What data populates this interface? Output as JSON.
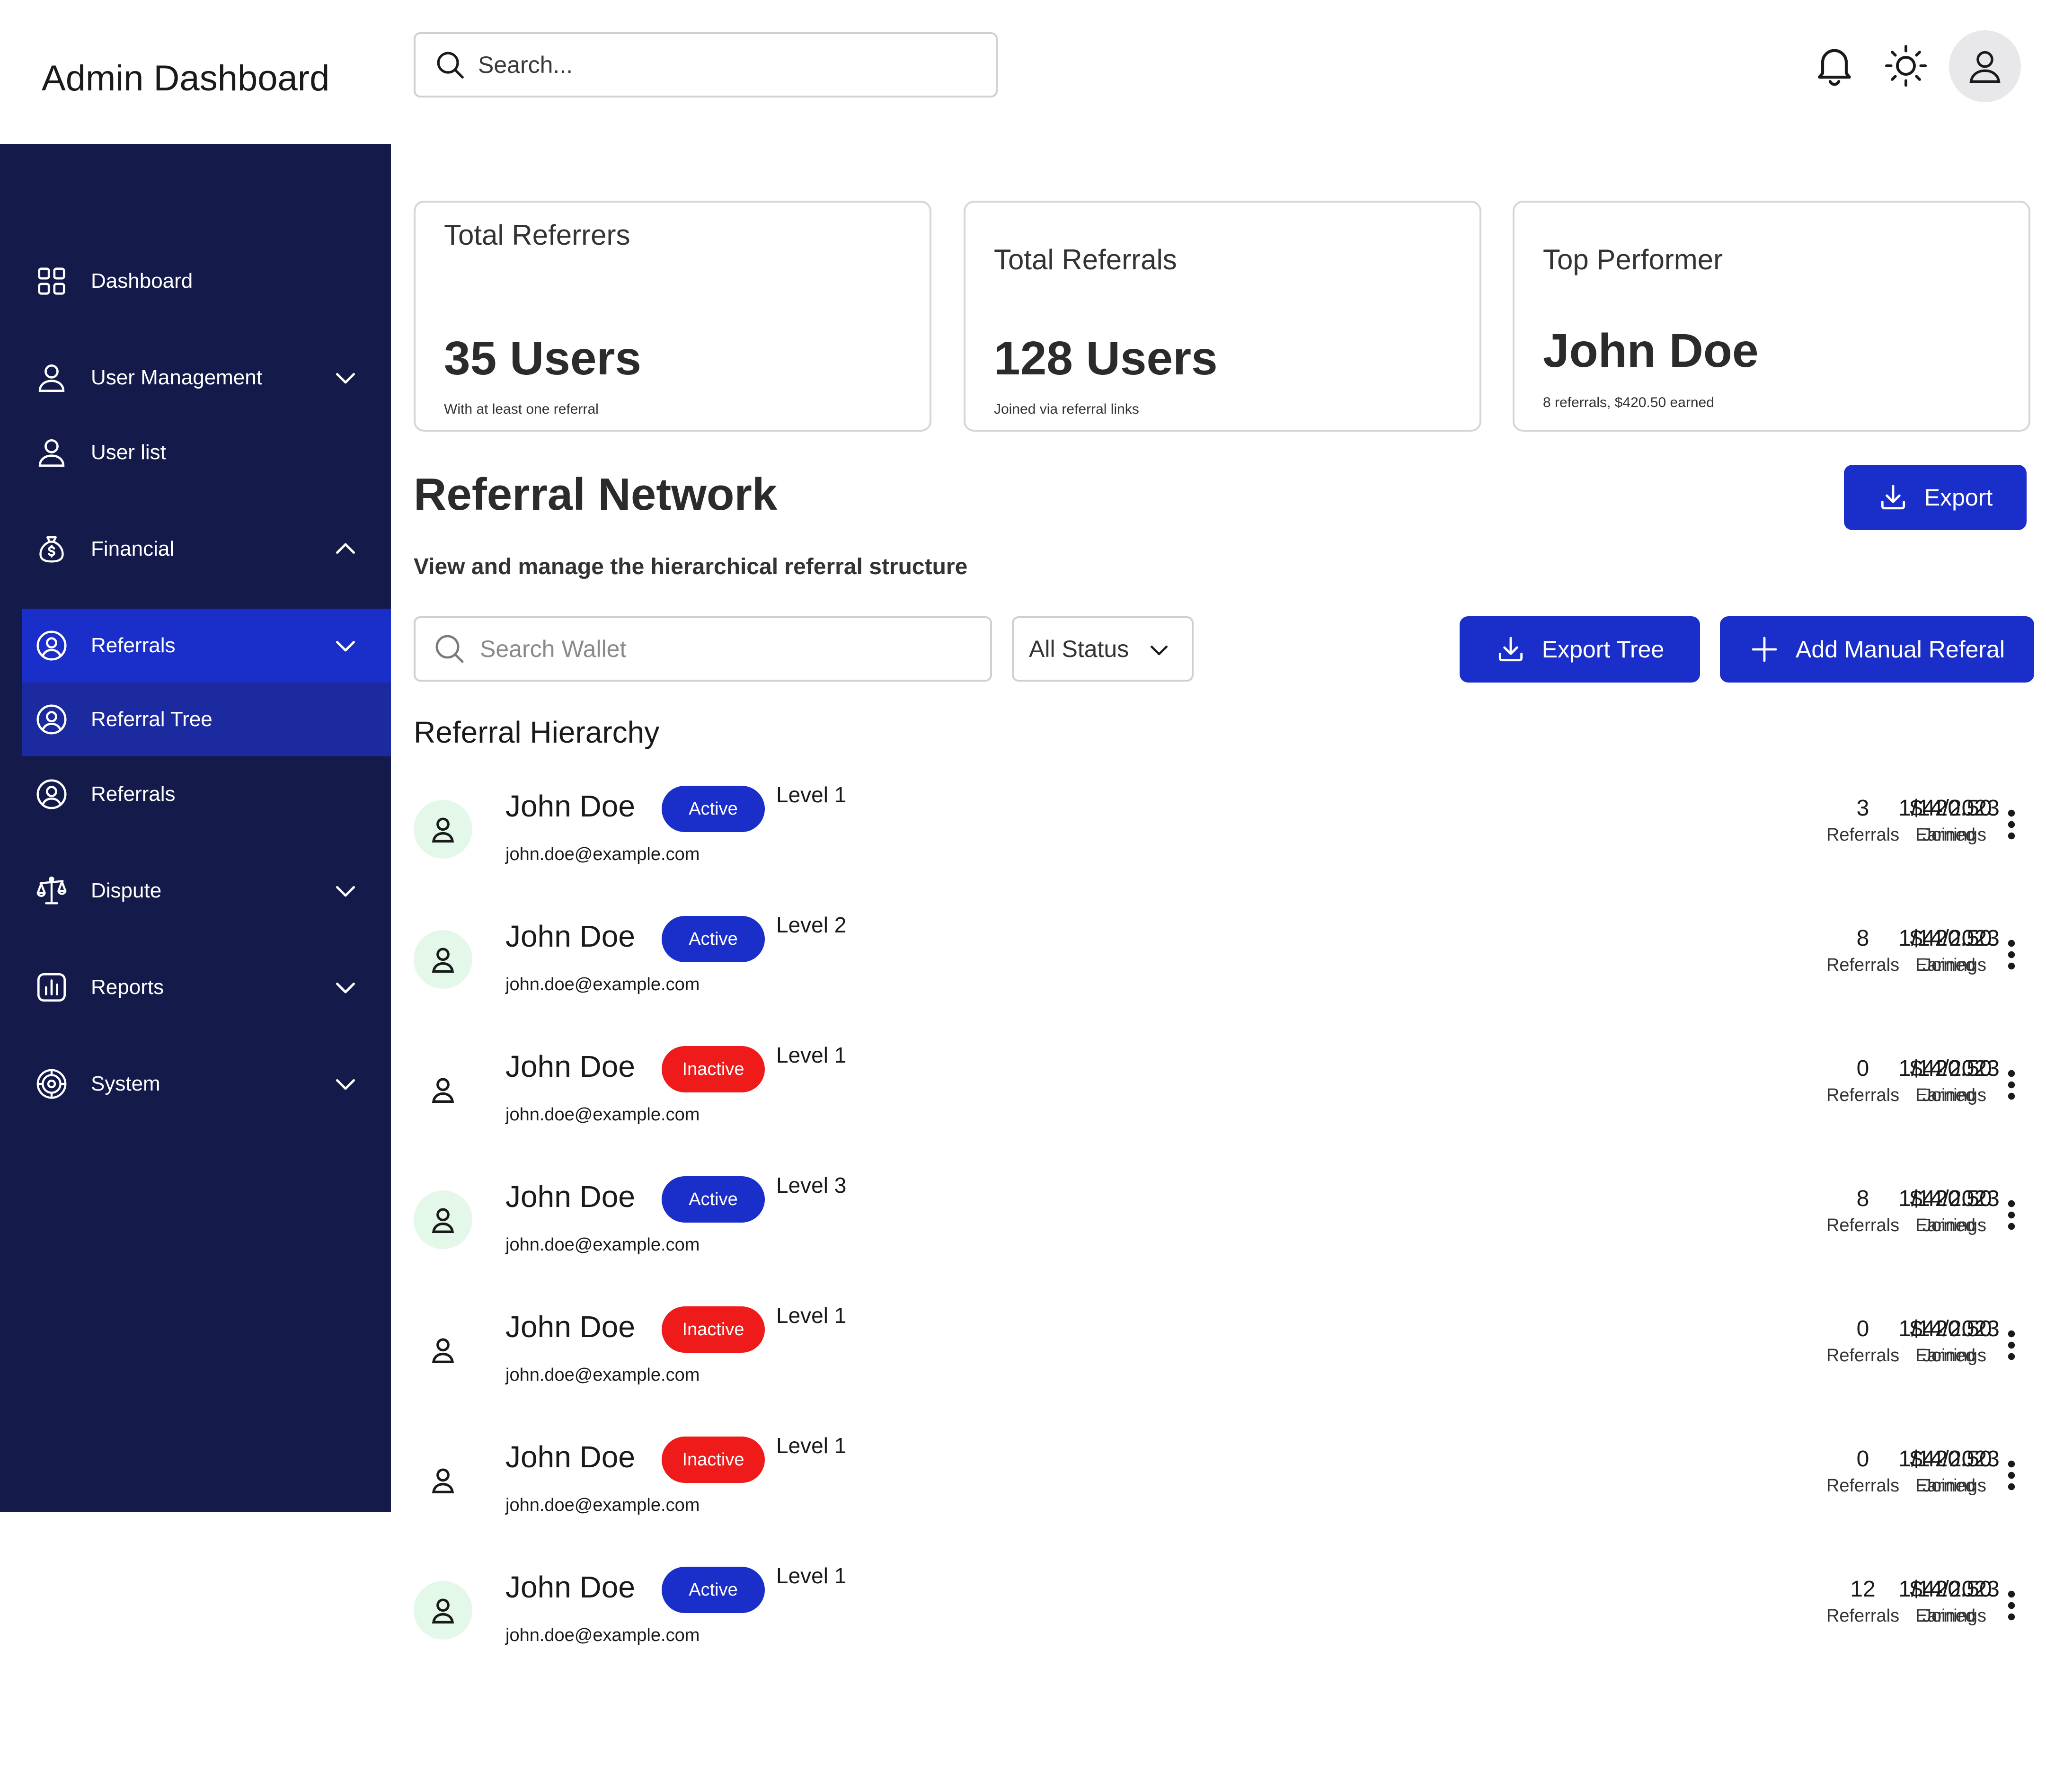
{
  "header": {
    "title": "Admin Dashboard",
    "search_placeholder": "Search..."
  },
  "sidebar": {
    "items": [
      {
        "label": "Dashboard",
        "icon": "grid-icon"
      },
      {
        "label": "User Management",
        "icon": "user-icon",
        "chevron": "down"
      },
      {
        "label": "User list",
        "icon": "user-icon"
      },
      {
        "label": "Financial",
        "icon": "money-bag-icon",
        "chevron": "up"
      },
      {
        "label": "Referrals",
        "icon": "user-circle-icon",
        "chevron": "down",
        "state": "active"
      },
      {
        "label": "Referral Tree",
        "icon": "user-circle-icon",
        "state": "selected"
      },
      {
        "label": "Referrals",
        "icon": "user-circle-icon"
      },
      {
        "label": "Dispute",
        "icon": "scale-icon",
        "chevron": "down"
      },
      {
        "label": "Reports",
        "icon": "bar-chart-icon",
        "chevron": "down"
      },
      {
        "label": "System",
        "icon": "gear-icon",
        "chevron": "down"
      }
    ]
  },
  "stats": [
    {
      "title": "Total Referrers",
      "value": "35 Users",
      "sub": "With at least one referral"
    },
    {
      "title": "Total Referrals",
      "value": "128 Users",
      "sub": "Joined via referral links"
    },
    {
      "title": "Top Performer",
      "value": "John Doe",
      "sub": "8 referrals, $420.50 earned"
    }
  ],
  "section": {
    "title": "Referral Network",
    "subtitle": "View and manage the hierarchical referral structure",
    "export_label": "Export"
  },
  "filters": {
    "wallet_placeholder": "Search Wallet",
    "status_value": "All Status",
    "export_tree_label": "Export Tree",
    "add_manual_label": "Add Manual Referal"
  },
  "hierarchy": {
    "title": "Referral Hierarchy",
    "referrals_label": "Referrals",
    "earnings_label": "Earnings",
    "joined_label": "Joined",
    "rows": [
      {
        "name": "John Doe",
        "email": "john.doe@example.com",
        "status": "Active",
        "level": "Level 1",
        "referrals": "3",
        "earnings": "$420.50",
        "joined": "1/14/2023"
      },
      {
        "name": "John Doe",
        "email": "john.doe@example.com",
        "status": "Active",
        "level": "Level 2",
        "referrals": "8",
        "earnings": "$420.50",
        "joined": "1/14/2023"
      },
      {
        "name": "John Doe",
        "email": "john.doe@example.com",
        "status": "Inactive",
        "level": "Level 1",
        "referrals": "0",
        "earnings": "$420.50",
        "joined": "1/14/2023"
      },
      {
        "name": "John Doe",
        "email": "john.doe@example.com",
        "status": "Active",
        "level": "Level 3",
        "referrals": "8",
        "earnings": "$420.50",
        "joined": "1/14/2023"
      },
      {
        "name": "John Doe",
        "email": "john.doe@example.com",
        "status": "Inactive",
        "level": "Level 1",
        "referrals": "0",
        "earnings": "$420.50",
        "joined": "1/14/2023"
      },
      {
        "name": "John Doe",
        "email": "john.doe@example.com",
        "status": "Inactive",
        "level": "Level 1",
        "referrals": "0",
        "earnings": "$420.50",
        "joined": "1/14/2023"
      },
      {
        "name": "John Doe",
        "email": "john.doe@example.com",
        "status": "Active",
        "level": "Level 1",
        "referrals": "12",
        "earnings": "$420.50",
        "joined": "1/14/2023"
      }
    ]
  },
  "colors": {
    "sidebar_bg": "#141a4a",
    "accent": "#1a2ec9",
    "inactive": "#ef1b1b",
    "avatar_active_bg": "#e4f8ea"
  }
}
